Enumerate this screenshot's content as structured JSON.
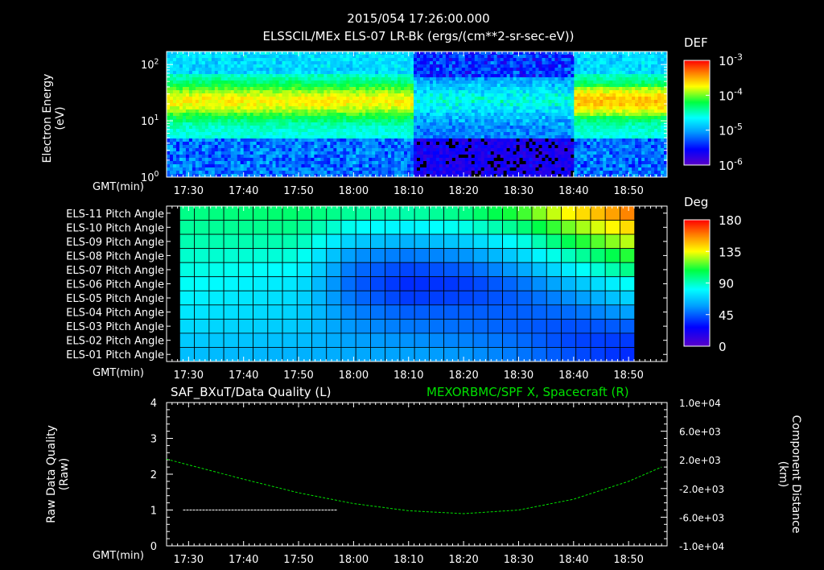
{
  "header": {
    "line1": "2015/054 17:26:00.000",
    "line2": "ELSSCIL/MEx ELS-07 LR-Bk  (ergs/(cm**2-sr-sec-eV))"
  },
  "time_axis_label": "GMT(min)",
  "colors": {
    "background": "#000000",
    "foreground": "#ffffff",
    "right_axis_series": "#00e000",
    "raw_quality_series": "#ffffff"
  },
  "chart_data": [
    {
      "type": "heatmap",
      "name": "spectrogram",
      "ylabel": "Electron Energy\n(eV)",
      "xlabel": "GMT(min)",
      "y_scale": "log",
      "ylim": [
        1,
        170
      ],
      "y_ticks": [
        "10^0",
        "10^1",
        "10^2"
      ],
      "x_tick_labels": [
        "17:30",
        "17:40",
        "17:50",
        "18:00",
        "18:10",
        "18:20",
        "18:30",
        "18:40",
        "18:50"
      ],
      "colorbar": {
        "title": "DEF",
        "scale": "log",
        "range": [
          1e-06,
          0.001
        ],
        "tick_labels": [
          "10^-3",
          "10^-4",
          "10^-5",
          "10^-6"
        ]
      }
    },
    {
      "type": "heatmap",
      "name": "pitch_angle",
      "xlabel": "GMT(min)",
      "row_labels": [
        "ELS-11 Pitch Angle",
        "ELS-10 Pitch Angle",
        "ELS-09 Pitch Angle",
        "ELS-08 Pitch Angle",
        "ELS-07 Pitch Angle",
        "ELS-06 Pitch Angle",
        "ELS-05 Pitch Angle",
        "ELS-04 Pitch Angle",
        "ELS-03 Pitch Angle",
        "ELS-02 Pitch Angle",
        "ELS-01 Pitch Angle"
      ],
      "x_tick_labels": [
        "17:30",
        "17:40",
        "17:50",
        "18:00",
        "18:10",
        "18:20",
        "18:30",
        "18:40",
        "18:50"
      ],
      "colorbar": {
        "title": "Deg",
        "range": [
          0,
          180
        ],
        "tick_labels": [
          "180",
          "135",
          "90",
          "45",
          "0"
        ]
      },
      "pitch_angle_deg_at_times": {
        "times": [
          "17:30",
          "17:50",
          "18:00",
          "18:10",
          "18:20",
          "18:30",
          "18:40",
          "18:50"
        ],
        "rows": [
          [
            98,
            102,
            95,
            93,
            98,
            112,
            138,
            158
          ],
          [
            95,
            98,
            82,
            78,
            84,
            98,
            122,
            142
          ],
          [
            92,
            92,
            68,
            62,
            68,
            82,
            108,
            128
          ],
          [
            88,
            86,
            55,
            50,
            55,
            70,
            92,
            112
          ],
          [
            85,
            80,
            48,
            40,
            45,
            58,
            78,
            98
          ],
          [
            82,
            75,
            45,
            35,
            38,
            48,
            65,
            82
          ],
          [
            78,
            72,
            48,
            38,
            40,
            45,
            55,
            70
          ],
          [
            75,
            70,
            52,
            45,
            45,
            45,
            48,
            58
          ],
          [
            72,
            68,
            55,
            50,
            48,
            45,
            42,
            45
          ],
          [
            68,
            65,
            58,
            55,
            52,
            48,
            40,
            38
          ],
          [
            65,
            62,
            60,
            58,
            56,
            50,
            42,
            35
          ]
        ]
      }
    },
    {
      "type": "line",
      "name": "quality_and_position",
      "title_left": "SAF_BXuT/Data Quality (L)",
      "title_right": "MEXORBMC/SPF X, Spacecraft (R)",
      "ylabel_left": "Raw Data Quality\n(Raw)",
      "ylabel_right": "Component Distance\n(km)",
      "xlabel": "GMT(min)",
      "ylim_left": [
        0,
        4
      ],
      "y_ticks_left": [
        "4",
        "3",
        "2",
        "1",
        "0"
      ],
      "ylim_right": [
        -10000,
        10000
      ],
      "y_ticks_right": [
        "1.0e+04",
        "6.0e+03",
        "2.0e+03",
        "-2.0e+03",
        "-6.0e+03",
        "-1.0e+04"
      ],
      "x_tick_labels": [
        "17:30",
        "17:40",
        "17:50",
        "18:00",
        "18:10",
        "18:20",
        "18:30",
        "18:40",
        "18:50"
      ],
      "series": [
        {
          "name": "SAF_BXuT/Data Quality",
          "axis": "left",
          "segments": [
            {
              "x": [
                "17:29",
                "17:57"
              ],
              "y": [
                1,
                1
              ]
            },
            {
              "x": [
                "17:57",
                "18:51"
              ],
              "y": [
                0,
                0
              ]
            }
          ]
        },
        {
          "name": "MEXORBMC/SPF X, Spacecraft",
          "axis": "right",
          "x": [
            "17:26",
            "17:30",
            "17:40",
            "17:50",
            "18:00",
            "18:10",
            "18:20",
            "18:30",
            "18:40",
            "18:50",
            "18:56"
          ],
          "y": [
            2100,
            1300,
            -700,
            -2600,
            -4100,
            -5100,
            -5500,
            -5000,
            -3500,
            -1000,
            1000
          ]
        }
      ]
    }
  ]
}
